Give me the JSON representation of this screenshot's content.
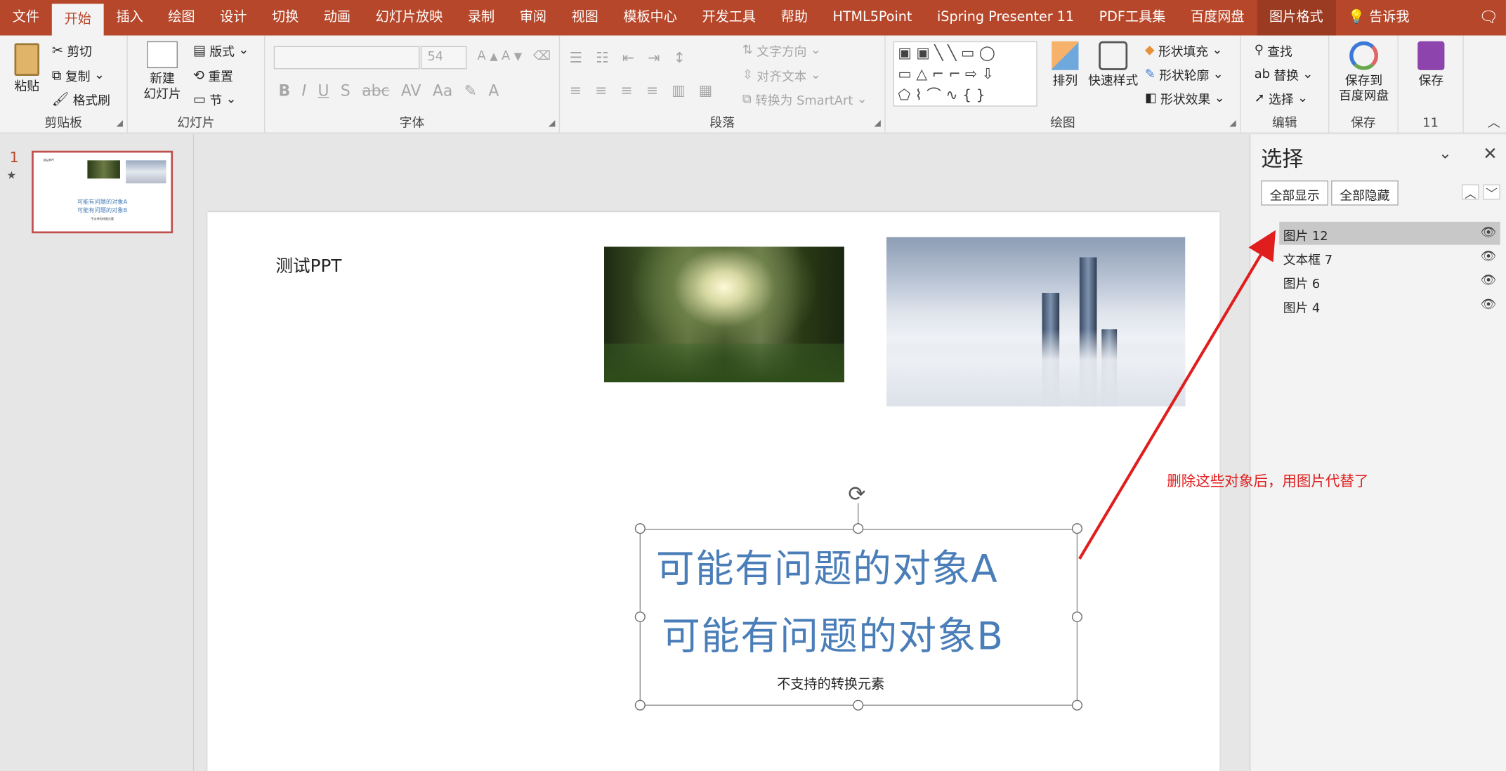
{
  "menu": {
    "items": [
      "文件",
      "开始",
      "插入",
      "绘图",
      "设计",
      "切换",
      "动画",
      "幻灯片放映",
      "录制",
      "审阅",
      "视图",
      "模板中心",
      "开发工具",
      "帮助",
      "HTML5Point",
      "iSpring Presenter 11",
      "PDF工具集",
      "百度网盘",
      "图片格式"
    ],
    "tell": "告诉我"
  },
  "ribbon": {
    "clipboard": {
      "paste": "粘贴",
      "cut": "剪切",
      "copy": "复制",
      "painter": "格式刷",
      "label": "剪贴板"
    },
    "slides": {
      "new": "新建",
      "new2": "幻灯片",
      "layout": "版式",
      "reset": "重置",
      "section": "节",
      "label": "幻灯片"
    },
    "font": {
      "size": "54",
      "label": "字体"
    },
    "paragraph": {
      "textdir": "文字方向",
      "align": "对齐文本",
      "smartart": "转换为 SmartArt",
      "label": "段落"
    },
    "drawing": {
      "arrange": "排列",
      "quick": "快速样式",
      "fill": "形状填充",
      "outline": "形状轮廓",
      "effect": "形状效果",
      "label": "绘图"
    },
    "editing": {
      "find": "查找",
      "replace": "替换",
      "select": "选择",
      "label": "编辑"
    },
    "save": {
      "baidu1": "保存到",
      "baidu2": "百度网盘",
      "save": "保存",
      "label": "保存",
      "label2": "11"
    }
  },
  "slidepanel": {
    "number": "1",
    "star": "★"
  },
  "slide": {
    "title": "测试PPT",
    "lineA": "可能有问题的对象A",
    "lineB": "可能有问题的对象B",
    "caption": "不支持的转换元素",
    "thumb_lines": [
      "可能有问题的对象A",
      "可能有问题的对象B",
      "不支持的转换元素"
    ],
    "thumb_title": "测试PPT"
  },
  "selection": {
    "title": "选择",
    "show_all": "全部显示",
    "hide_all": "全部隐藏",
    "items": [
      "图片 12",
      "文本框 7",
      "图片 6",
      "图片 4"
    ]
  },
  "annotation": "删除这些对象后，用图片代替了",
  "colors": {
    "accent": "#b7472a",
    "annotation": "#e01e1e",
    "text_blue": "#4a7eb8"
  }
}
